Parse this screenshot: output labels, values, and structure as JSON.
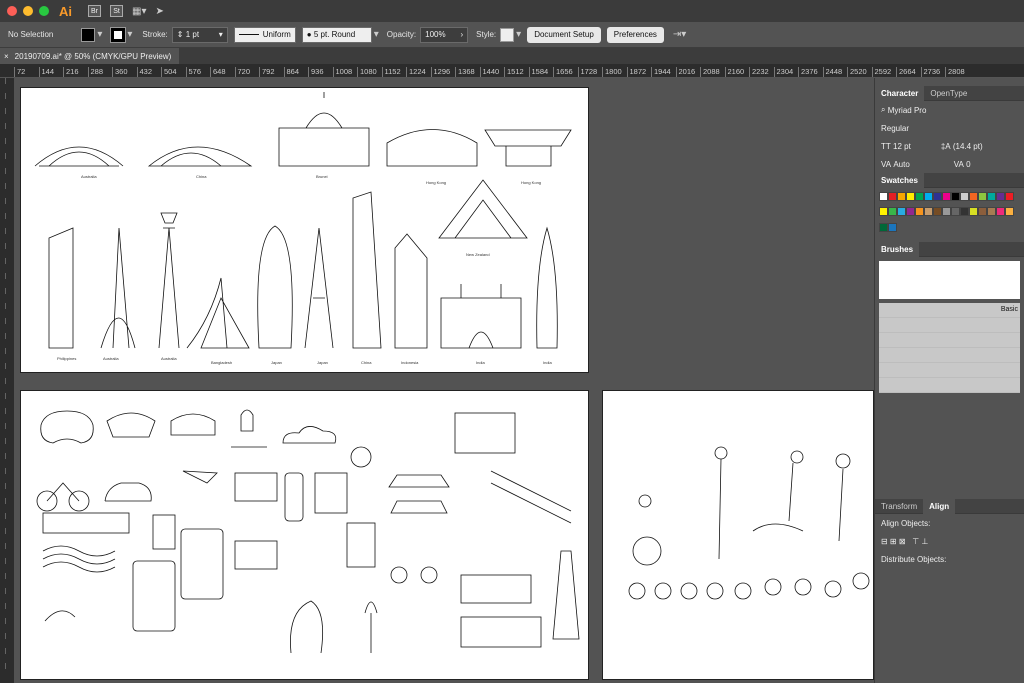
{
  "titlebar": {
    "app": "Ai",
    "bridge": "Br",
    "stock": "St"
  },
  "control": {
    "selection": "No Selection",
    "stroke_label": "Stroke:",
    "stroke_value": "1 pt",
    "profile": "Uniform",
    "brush": "5 pt. Round",
    "opacity_label": "Opacity:",
    "opacity_value": "100%",
    "style_label": "Style:",
    "doc_setup": "Document Setup",
    "preferences": "Preferences"
  },
  "doc_tab": {
    "title": "20190709.ai* @ 50% (CMYK/GPU Preview)",
    "close": "×"
  },
  "ruler": [
    "72",
    "144",
    "216",
    "288",
    "360",
    "432",
    "504",
    "576",
    "648",
    "720",
    "792",
    "864",
    "936",
    "1008",
    "1080",
    "1152",
    "1224",
    "1296",
    "1368",
    "1440",
    "1512",
    "1584",
    "1656",
    "1728",
    "1800",
    "1872",
    "1944",
    "2016",
    "2088",
    "2160",
    "2232",
    "2304",
    "2376",
    "2448",
    "2520",
    "2592",
    "2664",
    "2736",
    "2808"
  ],
  "artboard1": {
    "labels": [
      "Australia",
      "China",
      "Brunei",
      "Hong Kong",
      "Hong Kong",
      "New Zealand",
      "Philippines",
      "Australia",
      "Australia",
      "Bangladesh",
      "Japan",
      "Japan",
      "China",
      "Indonesia",
      "India",
      "India"
    ]
  },
  "character": {
    "tab": "Character",
    "tab2": "OpenType",
    "font": "Myriad Pro",
    "style": "Regular",
    "size": "12 pt",
    "leading": "(14.4 pt)",
    "kerning": "Auto",
    "tracking": "0"
  },
  "swatches": {
    "title": "Swatches",
    "colors": [
      "#ffffff",
      "#e31e24",
      "#f7a600",
      "#ffed00",
      "#00a651",
      "#00aeef",
      "#2e3192",
      "#ec008c",
      "#000000",
      "#cccccc",
      "#f26522",
      "#8dc63f",
      "#00a99d",
      "#662d91",
      "#ed1c24",
      "#fff200",
      "#39b54a",
      "#29abe2",
      "#92278f",
      "#f7941d",
      "#c69c6d",
      "#754c24",
      "#999999",
      "#666666",
      "#333333",
      "#d7df23",
      "#8b5e3c",
      "#a67c52",
      "#ee2a7b",
      "#fbb040",
      "#006838",
      "#1b75bc"
    ]
  },
  "brushes": {
    "title": "Brushes",
    "basic": "Basic"
  },
  "transform": {
    "tab": "Transform",
    "align_tab": "Align",
    "align_objects": "Align Objects:",
    "distribute_objects": "Distribute Objects:"
  }
}
